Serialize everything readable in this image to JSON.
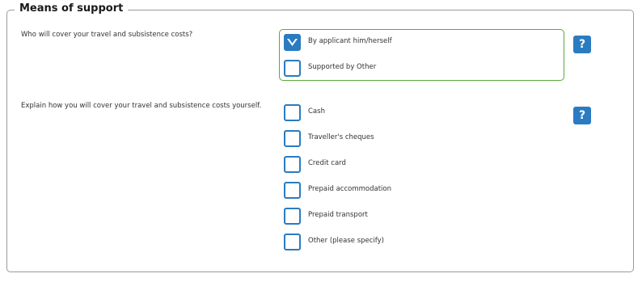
{
  "section": {
    "title": "Means of support"
  },
  "question1": {
    "label": "Who will cover your travel and subsistence costs?",
    "options": [
      {
        "label": "By applicant him/herself",
        "checked": true
      },
      {
        "label": "Supported by Other",
        "checked": false
      }
    ],
    "help_icon": "question-mark-icon",
    "help_label": "?"
  },
  "question2": {
    "label": "Explain how you will cover your travel and subsistence costs yourself.",
    "options": [
      {
        "label": "Cash",
        "checked": false
      },
      {
        "label": "Traveller's cheques",
        "checked": false
      },
      {
        "label": "Credit card",
        "checked": false
      },
      {
        "label": "Prepaid accommodation",
        "checked": false
      },
      {
        "label": "Prepaid transport",
        "checked": false
      },
      {
        "label": "Other (please specify)",
        "checked": false
      }
    ],
    "help_icon": "question-mark-icon",
    "help_label": "?"
  },
  "colors": {
    "accent": "#2a7bc2",
    "group_border": "#5aa83c",
    "fieldset_border": "#9a9a9a"
  }
}
